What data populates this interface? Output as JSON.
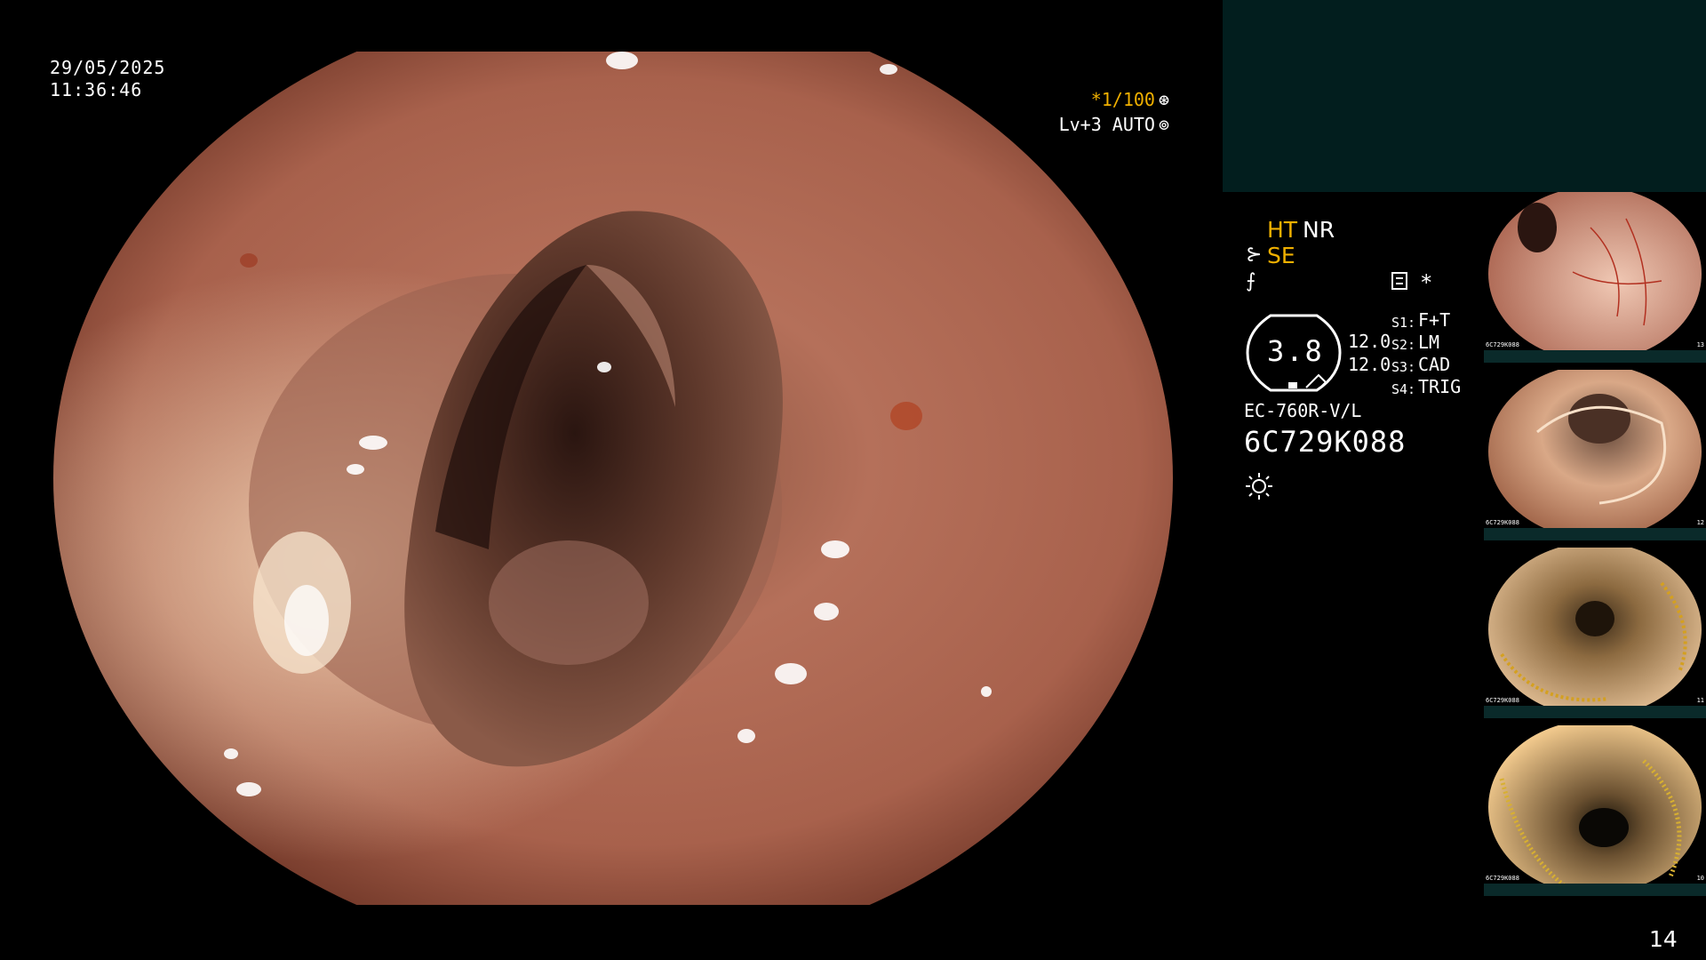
{
  "overlay": {
    "date": "29/05/2025",
    "time": "11:36:46",
    "shutter": "*1/100",
    "exposure": "Lv+3 AUTO"
  },
  "modes": {
    "ht": "HT",
    "nr": "NR",
    "se": "SE",
    "asterisk": "*"
  },
  "gauge": {
    "value": "3.8",
    "readout_1": "12.0",
    "readout_2": "12.0"
  },
  "scope_settings": [
    {
      "slot": "S1:",
      "value": "F+T"
    },
    {
      "slot": "S2:",
      "value": "LM"
    },
    {
      "slot": "S3:",
      "value": "CAD"
    },
    {
      "slot": "S4:",
      "value": "TRIG"
    }
  ],
  "scope": {
    "model": "EC-760R-V/L",
    "serial": "6C729K088"
  },
  "thumbnails": [
    {
      "serial": "6C729K088",
      "index": "13"
    },
    {
      "serial": "6C729K088",
      "index": "12"
    },
    {
      "serial": "6C729K088",
      "index": "11"
    },
    {
      "serial": "6C729K088",
      "index": "10"
    }
  ],
  "page_number": "14",
  "colors": {
    "accent_orange": "#f0b000",
    "panel_teal": "#021e1e",
    "mucosa": "#b5705a"
  }
}
